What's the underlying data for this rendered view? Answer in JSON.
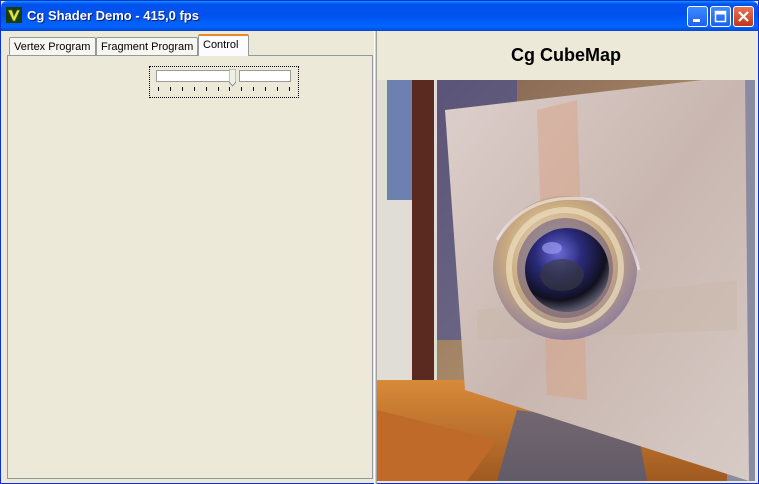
{
  "window": {
    "title": "Cg Shader Demo - 415,0 fps",
    "controls": [
      "minimize",
      "maximize",
      "close"
    ]
  },
  "tabs": [
    {
      "label": "Vertex Program",
      "active": false
    },
    {
      "label": "Fragment Program",
      "active": false
    },
    {
      "label": "Control",
      "active": true
    }
  ],
  "control": {
    "slider": {
      "value_fraction": 0.56,
      "tick_count": 12
    }
  },
  "render": {
    "title": "Cg CubeMap"
  },
  "colors": {
    "titlebar": "#0054e3",
    "face": "#ece9d8",
    "active_tab_accent": "#e68b2c"
  }
}
